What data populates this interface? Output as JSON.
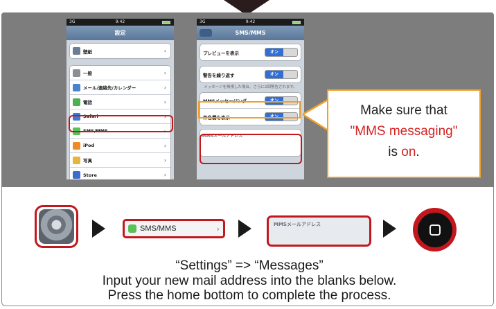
{
  "phone1": {
    "time": "9:42",
    "signal": "3G",
    "title": "設定",
    "rows": [
      {
        "label": "壁紙",
        "color": "#6a7d96"
      },
      {
        "label": "一般",
        "color": "#8a8f96"
      },
      {
        "label": "メール/連絡先/カレンダー",
        "color": "#4a83c9"
      },
      {
        "label": "電話",
        "color": "#4caf50"
      },
      {
        "label": "Safari",
        "color": "#3a7bd5"
      },
      {
        "label": "SMS/MMS",
        "color": "#5ac15a"
      },
      {
        "label": "iPod",
        "color": "#f08a24"
      },
      {
        "label": "写真",
        "color": "#e8b440"
      },
      {
        "label": "Store",
        "color": "#3c6ec9"
      }
    ]
  },
  "phone2": {
    "time": "9:42",
    "signal": "3G",
    "title": "SMS/MMS",
    "rows": [
      {
        "label": "プレビューを表示",
        "toggle": "オン"
      },
      {
        "label": "警告を繰り返す",
        "toggle": "オン"
      },
      {
        "label": "MMSメッセージング",
        "toggle": "オン"
      },
      {
        "label": "件名欄を表示",
        "toggle": "オン"
      }
    ],
    "note": "メッセージを無視した場合、さらに2回警告されます。",
    "mms_address_label": "MMSメールアドレス"
  },
  "callout": {
    "line1": "Make sure that",
    "line2": "\"MMS messaging\"",
    "line3_prefix": "is ",
    "line3_on": "on",
    "line3_suffix": "."
  },
  "steps": {
    "sms_label": "SMS/MMS",
    "mms_label": "MMSメールアドレス"
  },
  "captions": {
    "line1": "“Settings” => “Messages”",
    "line2": "Input your new mail address into the blanks below.",
    "line3": "Press the home bottom to complete the process."
  },
  "colors": {
    "highlight_red": "#c2171c",
    "highlight_orange": "#f0a12a",
    "accent_red_text": "#d62424"
  }
}
